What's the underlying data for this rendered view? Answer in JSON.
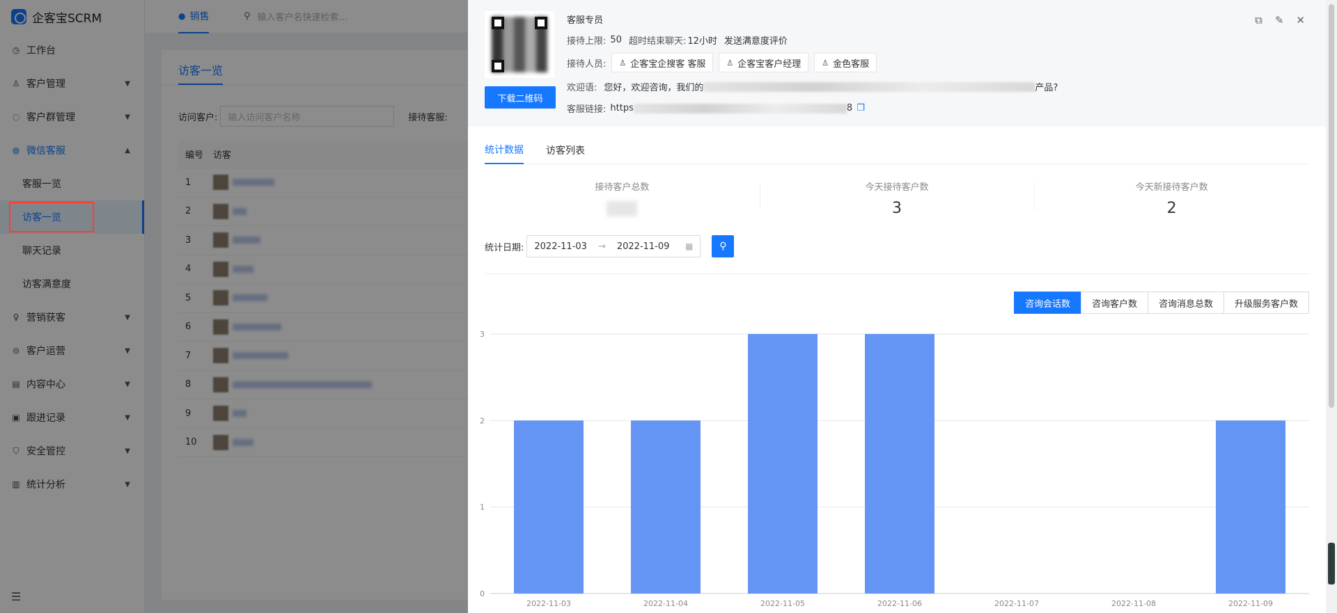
{
  "app": {
    "name": "企客宝SCRM"
  },
  "sidebar": {
    "items": [
      {
        "label": "工作台",
        "icon": "dashboard-icon"
      },
      {
        "label": "客户管理",
        "icon": "user-icon"
      },
      {
        "label": "客户群管理",
        "icon": "chat-group-icon"
      },
      {
        "label": "微信客服",
        "icon": "message-icon",
        "expanded": true,
        "children": [
          {
            "label": "客服一览"
          },
          {
            "label": "访客一览",
            "selected": true
          },
          {
            "label": "聊天记录"
          },
          {
            "label": "访客满意度"
          }
        ]
      },
      {
        "label": "营销获客",
        "icon": "bulb-icon"
      },
      {
        "label": "客户运营",
        "icon": "operation-icon"
      },
      {
        "label": "内容中心",
        "icon": "content-icon"
      },
      {
        "label": "跟进记录",
        "icon": "record-icon"
      },
      {
        "label": "安全管控",
        "icon": "shield-icon"
      },
      {
        "label": "统计分析",
        "icon": "chart-icon"
      }
    ]
  },
  "topbar": {
    "tab_label": "销售",
    "search_placeholder": "输入客户名快速检索..."
  },
  "page": {
    "title": "访客一览",
    "filter_visitor_label": "访问客户:",
    "filter_visitor_placeholder": "输入访问客户名称",
    "filter_staff_label": "接待客服:",
    "table_headers": [
      "编号",
      "访客"
    ],
    "rows": [
      "1",
      "2",
      "3",
      "4",
      "5",
      "6",
      "7",
      "8",
      "9",
      "10"
    ]
  },
  "drawer": {
    "download_qr_label": "下载二维码",
    "service_name": "客服专员",
    "limit_label": "接待上限:",
    "limit_value": "50",
    "timeout_label": "超时结束聊天:",
    "timeout_value": "12小时",
    "satisfaction_label": "发送满意度评价",
    "staff_label": "接待人员:",
    "staff": [
      "企客宝企搜客 客服",
      "企客宝客户经理",
      "金色客服"
    ],
    "welcome_label": "欢迎语:",
    "welcome_prefix": "您好，欢迎咨询，我们的",
    "welcome_suffix": "产品?",
    "link_label": "客服链接:",
    "link_prefix": "https",
    "link_suffix": "8",
    "tabs": [
      "统计数据",
      "访客列表"
    ],
    "stats": [
      {
        "label": "接待客户总数",
        "value": ""
      },
      {
        "label": "今天接待客户数",
        "value": "3"
      },
      {
        "label": "今天新接待客户数",
        "value": "2"
      }
    ],
    "date_label": "统计日期:",
    "date_start": "2022-11-03",
    "date_end": "2022-11-09",
    "metric_buttons": [
      "咨询会话数",
      "咨询客户数",
      "咨询消息总数",
      "升级服务客户数"
    ],
    "active_metric": "咨询会话数"
  },
  "colors": {
    "accent": "#1677ff",
    "bar": "#6495f5"
  },
  "chart_data": {
    "type": "bar",
    "categories": [
      "2022-11-03",
      "2022-11-04",
      "2022-11-05",
      "2022-11-06",
      "2022-11-07",
      "2022-11-08",
      "2022-11-09"
    ],
    "values": [
      2,
      2,
      3,
      3,
      0,
      0,
      2
    ],
    "ylim": [
      0,
      3
    ],
    "yticks": [
      0,
      1,
      2,
      3
    ],
    "grid": true
  }
}
